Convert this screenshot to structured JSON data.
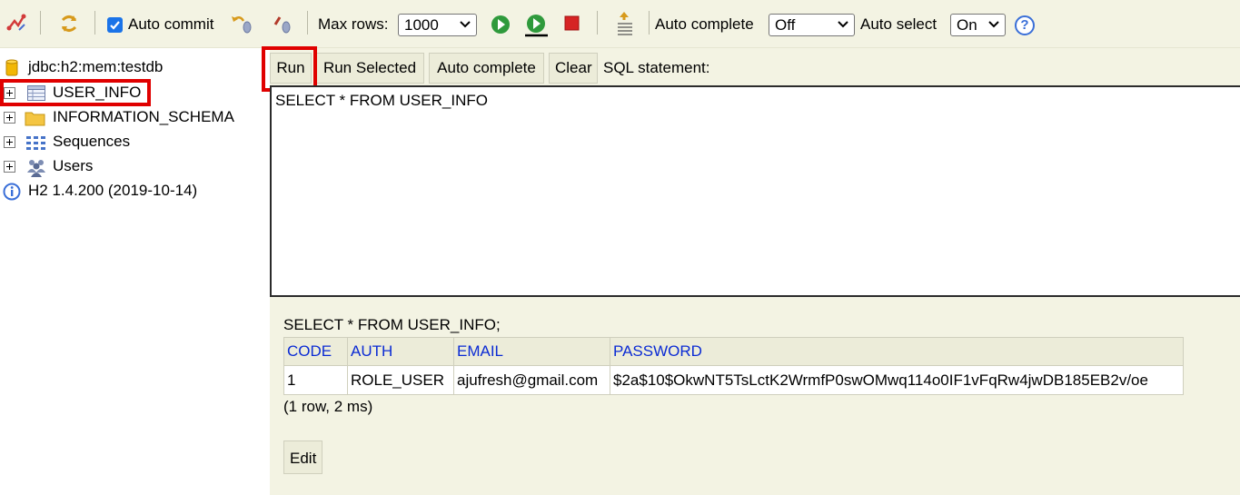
{
  "toolbar": {
    "auto_commit_label": "Auto commit",
    "auto_commit_checked": true,
    "max_rows_label": "Max rows:",
    "max_rows_value": "1000",
    "auto_complete_label": "Auto complete",
    "auto_complete_value": "Off",
    "auto_select_label": "Auto select",
    "auto_select_value": "On",
    "help_glyph": "?"
  },
  "sidebar": {
    "connection": "jdbc:h2:mem:testdb",
    "items": [
      {
        "label": "USER_INFO",
        "icon": "table-icon"
      },
      {
        "label": "INFORMATION_SCHEMA",
        "icon": "folder-icon"
      },
      {
        "label": "Sequences",
        "icon": "sequences-icon"
      },
      {
        "label": "Users",
        "icon": "users-icon"
      }
    ],
    "version": "H2 1.4.200 (2019-10-14)"
  },
  "query": {
    "buttons": {
      "run": "Run",
      "run_selected": "Run Selected",
      "auto_complete": "Auto complete",
      "clear": "Clear"
    },
    "sql_label": "SQL statement:",
    "sql_text": "SELECT * FROM USER_INFO"
  },
  "result": {
    "statement": "SELECT * FROM USER_INFO;",
    "columns": [
      "CODE",
      "AUTH",
      "EMAIL",
      "PASSWORD"
    ],
    "rows": [
      [
        "1",
        "ROLE_USER",
        "ajufresh@gmail.com",
        "$2a$10$OkwNT5TsLctK2WrmfP0swOMwq114o0IF1vFqRw4jwDB185EB2v/oe"
      ]
    ],
    "summary": "(1 row, 2 ms)",
    "edit_label": "Edit"
  },
  "colors": {
    "highlight": "#e00000",
    "panel_bg": "#f3f3e3",
    "header_text": "#0b2bd4"
  }
}
